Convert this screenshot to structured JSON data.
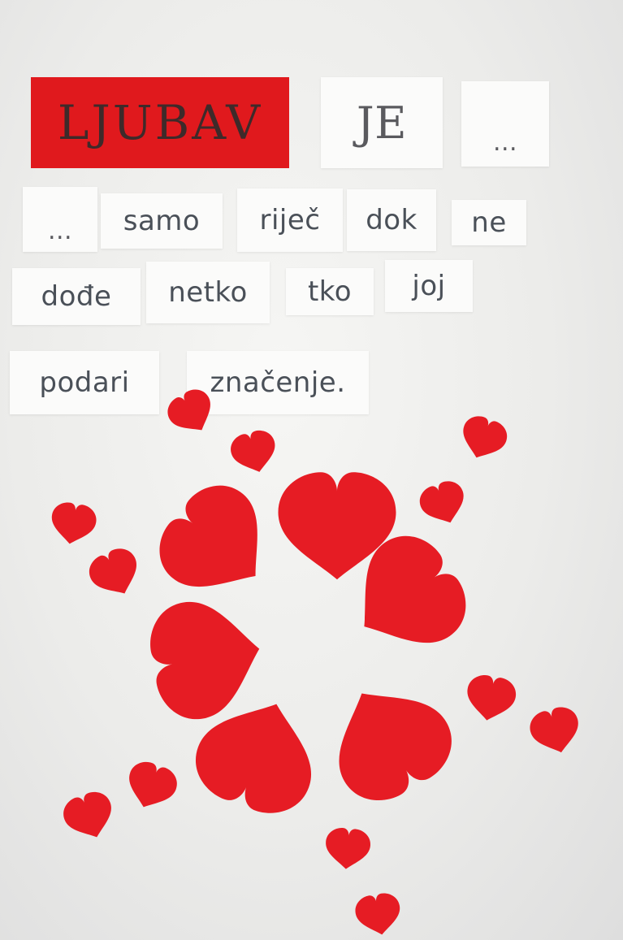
{
  "poster": {
    "title_word": "LJUBAV",
    "words": [
      "JE",
      "...",
      "...",
      "samo",
      "riječ",
      "dok",
      "ne",
      "dođe",
      "netko",
      "tko",
      "joj",
      "podari",
      "značenje."
    ]
  },
  "colors": {
    "heart_red": "#e61c24",
    "title_card": "#e0191d",
    "card": "#fbfbfa",
    "text": "#4a5058",
    "background": "#ececea"
  }
}
